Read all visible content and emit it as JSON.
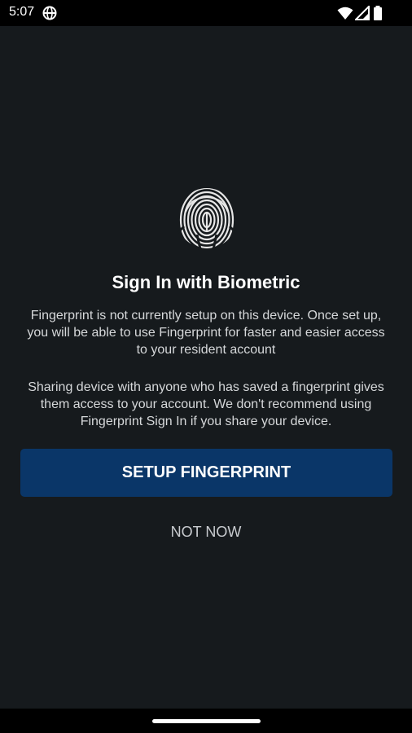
{
  "status_bar": {
    "time": "5:07",
    "icons": [
      "vpn-globe-icon",
      "wifi-icon",
      "cell-signal-icon",
      "battery-icon"
    ]
  },
  "biometric": {
    "icon": "fingerprint-icon",
    "title": "Sign In with Biometric",
    "description": "Fingerprint is not currently setup on this device. Once set up, you will be able to use Fingerprint for faster and easier access to your resident account",
    "warning": "Sharing device with anyone who has saved a fingerprint gives them access to your account. We don't recommend using Fingerprint Sign In if you share your device.",
    "primary_button": "SETUP FINGERPRINT",
    "secondary_button": "NOT NOW"
  },
  "colors": {
    "background": "#161a1d",
    "primary_button": "#0a3668",
    "text": "#ffffff"
  }
}
